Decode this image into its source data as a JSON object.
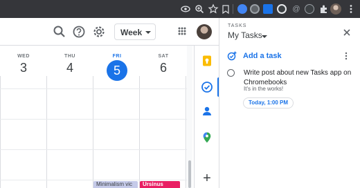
{
  "colors": {
    "accent": "#1a73e8",
    "chrome_toolbar": "#35363a",
    "event_minimalism": "#c5cae9",
    "event_ursinus": "#e91e63",
    "keep_yellow": "#fbbc04",
    "gridline": "#dadce0"
  },
  "browser": {
    "toolbar_icons": [
      "eye-icon",
      "zoom-icon",
      "bookmark-star-icon",
      "extension-1password-icon",
      "extension-circle-icon",
      "extension-screencast-icon",
      "extension-rec-icon",
      "extension-at-icon",
      "extension-grammar-icon",
      "extensions-puzzle-icon",
      "sidepanel-icon",
      "profile-avatar",
      "chrome-menu-icon"
    ]
  },
  "calendar": {
    "view_selector": "Week",
    "header_icons": [
      "search-icon",
      "help-icon",
      "settings-gear-icon",
      "google-apps-icon",
      "account-avatar"
    ],
    "days": [
      {
        "name": "WED",
        "number": "3",
        "today": false
      },
      {
        "name": "THU",
        "number": "4",
        "today": false
      },
      {
        "name": "FRI",
        "number": "5",
        "today": true
      },
      {
        "name": "SAT",
        "number": "6",
        "today": false
      }
    ],
    "events": [
      {
        "title": "Minimalism vic",
        "day": "FRI",
        "color": "#c5cae9"
      },
      {
        "title": "Ursinus",
        "day": "SAT",
        "color": "#e91e63"
      }
    ]
  },
  "side_rail": {
    "items": [
      "google-keep-icon",
      "google-tasks-icon",
      "google-contacts-icon",
      "google-maps-icon"
    ],
    "add_button": "+"
  },
  "tasks_panel": {
    "caption": "TASKS",
    "list_name": "My Tasks",
    "add_task_label": "Add a task",
    "tasks": [
      {
        "title": "Write post about new Tasks app on Chromebooks",
        "notes": "It's in the works!",
        "due": "Today, 1:00 PM"
      }
    ]
  }
}
